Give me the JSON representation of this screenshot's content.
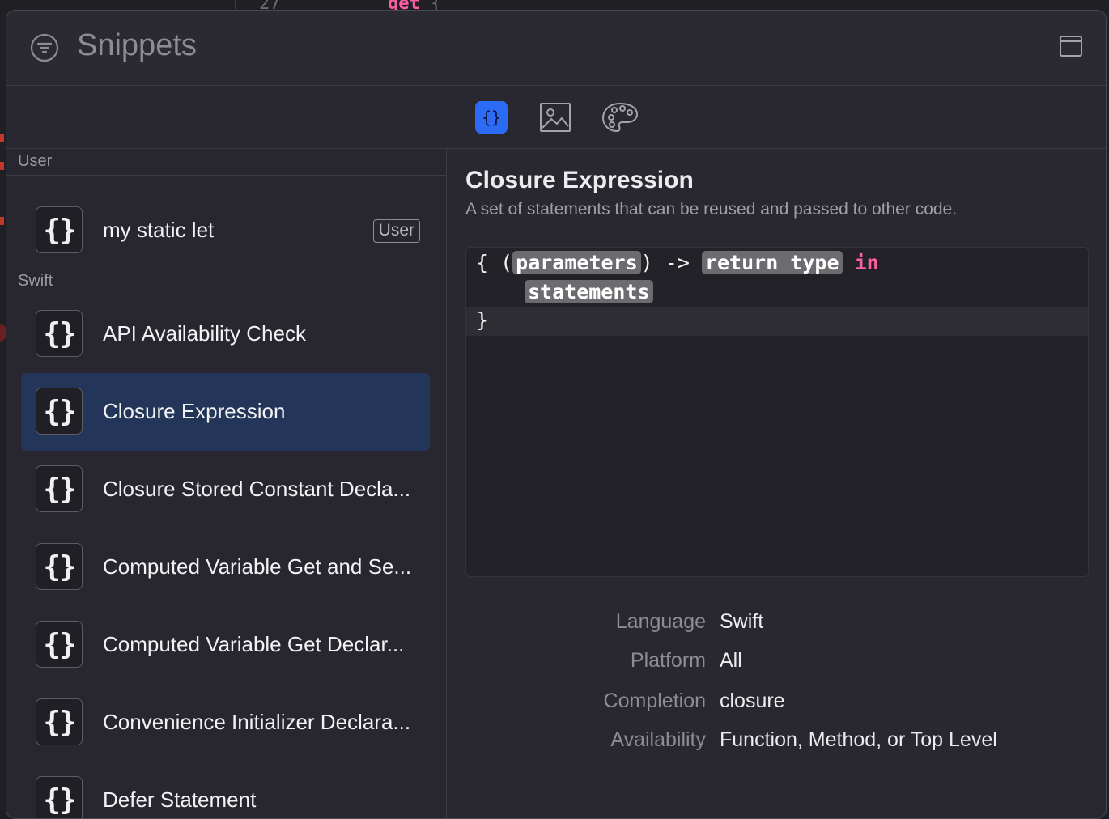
{
  "background_editor": {
    "line_number": "27",
    "keyword": "get",
    "brace": "{"
  },
  "panel": {
    "title": "Snippets"
  },
  "toolbar": {
    "tabs": [
      {
        "name": "code-snippets",
        "icon": "curly-braces-icon",
        "active": true
      },
      {
        "name": "media",
        "icon": "image-icon",
        "active": false
      },
      {
        "name": "colors",
        "icon": "palette-icon",
        "active": false
      }
    ],
    "accent": "#2c6cf5"
  },
  "sidebar": {
    "sections": [
      {
        "header": "User"
      },
      {
        "header": "Swift"
      }
    ],
    "user_items": [
      {
        "label": "my static let",
        "badge": "User"
      }
    ],
    "swift_items": [
      {
        "label": "API Availability Check"
      },
      {
        "label": "Closure Expression",
        "selected": true
      },
      {
        "label": "Closure Stored Constant Decla..."
      },
      {
        "label": "Computed Variable Get and Se..."
      },
      {
        "label": "Computed Variable Get Declar..."
      },
      {
        "label": "Convenience Initializer Declara..."
      },
      {
        "label": "Defer Statement"
      }
    ],
    "icon_glyph": "{}",
    "selected_color": "#24355a"
  },
  "detail": {
    "title": "Closure Expression",
    "description": "A set of statements that can be reused and passed to other code.",
    "code": {
      "open": "{ (",
      "param": "parameters",
      "arrow": ") -> ",
      "return_type": "return type",
      "keyword_in": "in",
      "statements": "statements",
      "close": "}"
    },
    "meta": [
      {
        "key": "Language",
        "value": "Swift"
      },
      {
        "key": "Platform",
        "value": "All"
      },
      {
        "key": "Completion",
        "value": "closure"
      },
      {
        "key": "Availability",
        "value": "Function, Method, or Top Level"
      }
    ]
  }
}
